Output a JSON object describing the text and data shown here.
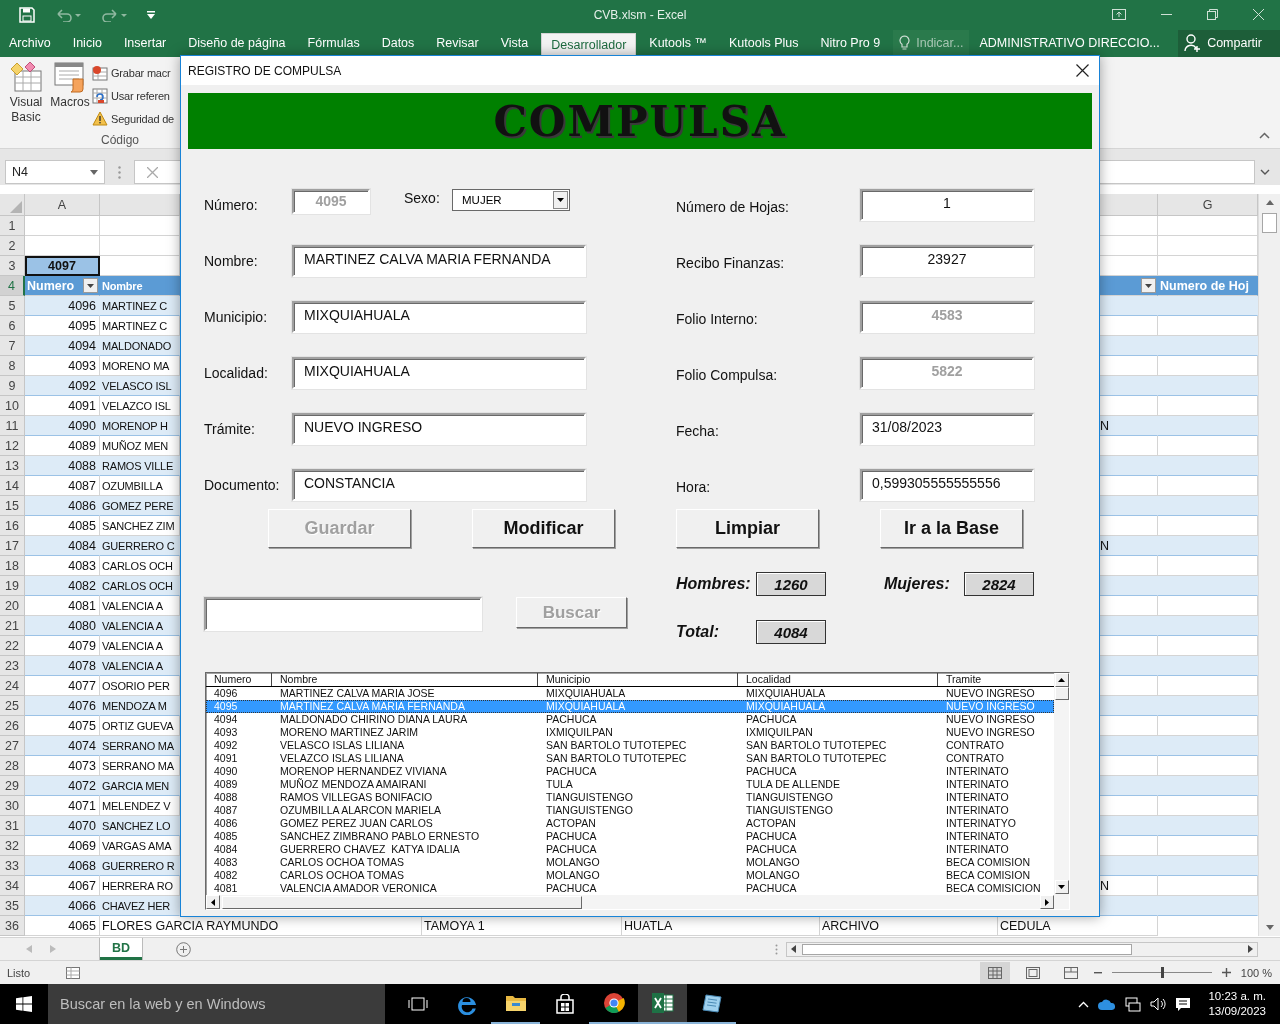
{
  "excel": {
    "title": "CVB.xlsm - Excel",
    "tabs": [
      {
        "label": "Archivo",
        "selected": false
      },
      {
        "label": "Inicio",
        "selected": false
      },
      {
        "label": "Insertar",
        "selected": false
      },
      {
        "label": "Diseño de página",
        "selected": false
      },
      {
        "label": "Fórmulas",
        "selected": false
      },
      {
        "label": "Datos",
        "selected": false
      },
      {
        "label": "Revisar",
        "selected": false
      },
      {
        "label": "Vista",
        "selected": false
      },
      {
        "label": "Desarrollador",
        "selected": true
      },
      {
        "label": "Kutools ™",
        "selected": false
      },
      {
        "label": "Kutools Plus",
        "selected": false
      },
      {
        "label": "Nitro Pro 9",
        "selected": false
      }
    ],
    "tell_me": "Indicar...",
    "account": "ADMINISTRATIVO DIRECCIO...",
    "share": "Compartir"
  },
  "ribbon": {
    "large_buttons": [
      {
        "label": "Visual Basic",
        "kind": "vba"
      },
      {
        "label": "Macros",
        "kind": "macros"
      }
    ],
    "small_buttons": [
      {
        "label": "Grabar macr",
        "kind": "record"
      },
      {
        "label": "Usar referen",
        "kind": "relative"
      },
      {
        "label": "Seguridad de",
        "kind": "warning"
      }
    ],
    "group_label": "Código"
  },
  "formula_bar": {
    "name_box": "N4"
  },
  "sheet": {
    "columns": {
      "a": "A",
      "g": "G"
    },
    "rows": [
      {
        "number": "1",
        "kind": "blank",
        "selected": false
      },
      {
        "number": "2",
        "kind": "blank",
        "selected": false
      },
      {
        "number": "3",
        "kind": "total",
        "selected": false,
        "a": "4097"
      },
      {
        "number": "4",
        "kind": "header",
        "selected": true,
        "a": "Numero",
        "b": "Nombre",
        "g": "Numero de Hoj"
      },
      {
        "number": "5",
        "kind": "data",
        "selected": false,
        "a": "4096",
        "b": "MARTINEZ C"
      },
      {
        "number": "6",
        "kind": "data",
        "selected": false,
        "a": "4095",
        "b": "MARTINEZ C"
      },
      {
        "number": "7",
        "kind": "data",
        "selected": false,
        "a": "4094",
        "b": "MALDONADO"
      },
      {
        "number": "8",
        "kind": "data",
        "selected": false,
        "a": "4093",
        "b": "MORENO MA"
      },
      {
        "number": "9",
        "kind": "data",
        "selected": false,
        "a": "4092",
        "b": "VELASCO ISL"
      },
      {
        "number": "10",
        "kind": "data",
        "selected": false,
        "a": "4091",
        "b": "VELAZCO ISL"
      },
      {
        "number": "11",
        "kind": "data",
        "selected": false,
        "a": "4090",
        "b": "MORENOP H",
        "f": "N"
      },
      {
        "number": "12",
        "kind": "data",
        "selected": false,
        "a": "4089",
        "b": "MUÑOZ MEN"
      },
      {
        "number": "13",
        "kind": "data",
        "selected": false,
        "a": "4088",
        "b": "RAMOS VILLE"
      },
      {
        "number": "14",
        "kind": "data",
        "selected": false,
        "a": "4087",
        "b": "OZUMBILLA"
      },
      {
        "number": "15",
        "kind": "data",
        "selected": false,
        "a": "4086",
        "b": "GOMEZ PERE"
      },
      {
        "number": "16",
        "kind": "data",
        "selected": false,
        "a": "4085",
        "b": "SANCHEZ ZIM"
      },
      {
        "number": "17",
        "kind": "data",
        "selected": false,
        "a": "4084",
        "b": "GUERRERO C",
        "f": "N"
      },
      {
        "number": "18",
        "kind": "data",
        "selected": false,
        "a": "4083",
        "b": "CARLOS OCH"
      },
      {
        "number": "19",
        "kind": "data",
        "selected": false,
        "a": "4082",
        "b": "CARLOS OCH"
      },
      {
        "number": "20",
        "kind": "data",
        "selected": false,
        "a": "4081",
        "b": "VALENCIA A"
      },
      {
        "number": "21",
        "kind": "data",
        "selected": false,
        "a": "4080",
        "b": "VALENCIA A"
      },
      {
        "number": "22",
        "kind": "data",
        "selected": false,
        "a": "4079",
        "b": "VALENCIA A"
      },
      {
        "number": "23",
        "kind": "data",
        "selected": false,
        "a": "4078",
        "b": "VALENCIA A"
      },
      {
        "number": "24",
        "kind": "data",
        "selected": false,
        "a": "4077",
        "b": "OSORIO PER"
      },
      {
        "number": "25",
        "kind": "data",
        "selected": false,
        "a": "4076",
        "b": "MENDOZA M"
      },
      {
        "number": "26",
        "kind": "data",
        "selected": false,
        "a": "4075",
        "b": "ORTIZ GUEVA"
      },
      {
        "number": "27",
        "kind": "data",
        "selected": false,
        "a": "4074",
        "b": "SERRANO MA"
      },
      {
        "number": "28",
        "kind": "data",
        "selected": false,
        "a": "4073",
        "b": "SERRANO MA"
      },
      {
        "number": "29",
        "kind": "data",
        "selected": false,
        "a": "4072",
        "b": "GARCIA MEN"
      },
      {
        "number": "30",
        "kind": "data",
        "selected": false,
        "a": "4071",
        "b": "MELENDEZ V"
      },
      {
        "number": "31",
        "kind": "data",
        "selected": false,
        "a": "4070",
        "b": "SANCHEZ LO"
      },
      {
        "number": "32",
        "kind": "data",
        "selected": false,
        "a": "4069",
        "b": "VARGAS AMA"
      },
      {
        "number": "33",
        "kind": "data",
        "selected": false,
        "a": "4068",
        "b": "GUERRERO R"
      },
      {
        "number": "34",
        "kind": "data",
        "selected": false,
        "a": "4067",
        "b": "HERRERA RO",
        "f": "N"
      },
      {
        "number": "35",
        "kind": "data",
        "selected": false,
        "a": "4066",
        "b": "CHAVEZ HER"
      },
      {
        "number": "36",
        "kind": "full",
        "selected": false,
        "cells": [
          "4065",
          "FLORES GARCIA RAYMUNDO",
          "TAMOYA 1",
          "HUATLA",
          "ARCHIVO",
          "CEDULA"
        ]
      }
    ]
  },
  "dialog": {
    "title": "REGISTRO DE COMPULSA",
    "banner": "COMPULSA",
    "numero": {
      "label": "Número:",
      "value": "4095",
      "disabled": true
    },
    "sexo": {
      "label": "Sexo:",
      "value": "MUJER"
    },
    "left_fields": [
      {
        "label": "Nombre:",
        "value": "MARTINEZ CALVA MARIA FERNANDA"
      },
      {
        "label": "Municipio:",
        "value": "MIXQUIAHUALA"
      },
      {
        "label": "Localidad:",
        "value": "MIXQUIAHUALA"
      },
      {
        "label": "Trámite:",
        "value": "NUEVO INGRESO"
      },
      {
        "label": "Documento:",
        "value": "CONSTANCIA"
      }
    ],
    "right_fields": [
      {
        "label": "Número de Hojas:",
        "value": "1",
        "kind": "number",
        "disabled": false
      },
      {
        "label": "Recibo Finanzas:",
        "value": "23927",
        "kind": "number",
        "disabled": false
      },
      {
        "label": "Folio Interno:",
        "value": "4583",
        "kind": "number",
        "disabled": true
      },
      {
        "label": "Folio Compulsa:",
        "value": "5822",
        "kind": "number",
        "disabled": true
      },
      {
        "label": "Fecha:",
        "value": "31/08/2023",
        "kind": "text",
        "disabled": false
      },
      {
        "label": "Hora:",
        "value": "0,599305555555556",
        "kind": "text",
        "disabled": false
      }
    ],
    "buttons": [
      {
        "label": "Guardar",
        "disabled": true
      },
      {
        "label": "Modificar",
        "disabled": false
      },
      {
        "label": "Limpiar",
        "disabled": false
      },
      {
        "label": "Ir a la Base",
        "disabled": false
      }
    ],
    "search_button": {
      "label": "Buscar",
      "disabled": true
    },
    "stats": [
      {
        "label": "Hombres:",
        "value": "1260"
      },
      {
        "label": "Mujeres:",
        "value": "2824"
      },
      {
        "label": "Total:",
        "value": "4084"
      }
    ],
    "list": {
      "columns": [
        "Numero",
        "Nombre",
        "Municipio",
        "Localidad",
        "Tramite"
      ],
      "rows": [
        {
          "selected": false,
          "cells": [
            "4096",
            "MARTINEZ CALVA MARIA JOSE",
            "MIXQUIAHUALA",
            "MIXQUIAHUALA",
            "NUEVO INGRESO"
          ]
        },
        {
          "selected": true,
          "cells": [
            "4095",
            "MARTINEZ CALVA MARIA FERNANDA",
            "MIXQUIAHUALA",
            "MIXQUIAHUALA",
            "NUEVO INGRESO"
          ]
        },
        {
          "selected": false,
          "cells": [
            "4094",
            "MALDONADO CHIRINO DIANA LAURA",
            "PACHUCA",
            "PACHUCA",
            "NUEVO INGRESO"
          ]
        },
        {
          "selected": false,
          "cells": [
            "4093",
            "MORENO MARTINEZ JARIM",
            "IXMIQUILPAN",
            "IXMIQUILPAN",
            "NUEVO INGRESO"
          ]
        },
        {
          "selected": false,
          "cells": [
            "4092",
            "VELASCO ISLAS LILIANA",
            "SAN BARTOLO TUTOTEPEC",
            "SAN BARTOLO TUTOTEPEC",
            "CONTRATO"
          ]
        },
        {
          "selected": false,
          "cells": [
            "4091",
            "VELAZCO ISLAS LILIANA",
            "SAN BARTOLO TUTOTEPEC",
            "SAN BARTOLO TUTOTEPEC",
            "CONTRATO"
          ]
        },
        {
          "selected": false,
          "cells": [
            "4090",
            "MORENOP HERNANDEZ VIVIANA",
            "PACHUCA",
            "PACHUCA",
            "INTERINATO"
          ]
        },
        {
          "selected": false,
          "cells": [
            "4089",
            "MUÑOZ MENDOZA AMAIRANI",
            "TULA",
            "TULA DE ALLENDE",
            "INTERINATO"
          ]
        },
        {
          "selected": false,
          "cells": [
            "4088",
            "RAMOS VILLEGAS BONIFACIO",
            "TIANGUISTENGO",
            "TIANGUISTENGO",
            "INTERINATO"
          ]
        },
        {
          "selected": false,
          "cells": [
            "4087",
            "OZUMBILLA ALARCON MARIELA",
            "TIANGUISTENGO",
            "TIANGUISTENGO",
            "INTERINATO"
          ]
        },
        {
          "selected": false,
          "cells": [
            "4086",
            "GOMEZ PEREZ JUAN CARLOS",
            "ACTOPAN",
            "ACTOPAN",
            "INTERINATYO"
          ]
        },
        {
          "selected": false,
          "cells": [
            "4085",
            "SANCHEZ ZIMBRANO PABLO ERNESTO",
            "PACHUCA",
            "PACHUCA",
            "INTERINATO"
          ]
        },
        {
          "selected": false,
          "cells": [
            "4084",
            "GUERRERO CHAVEZ  KATYA IDALIA",
            "PACHUCA",
            "PACHUCA",
            "INTERINATO"
          ]
        },
        {
          "selected": false,
          "cells": [
            "4083",
            "CARLOS OCHOA TOMAS",
            "MOLANGO",
            "MOLANGO",
            "BECA COMISION"
          ]
        },
        {
          "selected": false,
          "cells": [
            "4082",
            "CARLOS OCHOA TOMAS",
            "MOLANGO",
            "MOLANGO",
            "BECA COMISION"
          ]
        },
        {
          "selected": false,
          "cells": [
            "4081",
            "VALENCIA AMADOR VERONICA",
            "PACHUCA",
            "PACHUCA",
            "BECA COMISICION"
          ]
        }
      ]
    }
  },
  "sheet_tabs": [
    {
      "label": "BD",
      "selected": true
    }
  ],
  "status": {
    "text": "Listo",
    "zoom": "100 %",
    "zoom_slider": {
      "level": 0.5
    }
  },
  "taskbar": {
    "search_placeholder": "Buscar en la web y en Windows",
    "apps": [
      {
        "kind": "browser",
        "running": false,
        "selected": false
      },
      {
        "kind": "folder",
        "running": true,
        "selected": false
      },
      {
        "kind": "store",
        "running": false,
        "selected": false
      },
      {
        "kind": "wheel",
        "running": true,
        "selected": false
      },
      {
        "kind": "spreadsheet",
        "running": true,
        "selected": true
      },
      {
        "kind": "document",
        "running": true,
        "selected": false
      }
    ],
    "time": "10:23 a. m.",
    "date": "13/09/2023"
  }
}
